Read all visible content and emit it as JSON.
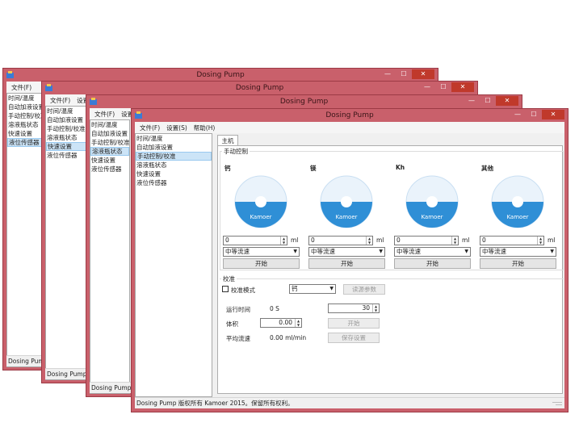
{
  "app": {
    "title": "Dosing Pump",
    "min_glyph": "—",
    "max_glyph": "☐",
    "close_glyph": "✕"
  },
  "menu": {
    "file": "文件(F)",
    "settings": "设置(S)",
    "help": "帮助(H)",
    "settings_truncated": "设置"
  },
  "nav_items": [
    "时间/温度",
    "自动加液设置",
    "手动控制/校准",
    "溶液瓶状态",
    "快速设置",
    "液位传感器"
  ],
  "back_windows": {
    "w1_nav": [
      "时间/温度",
      "自动加液设置",
      "手动控制/校准",
      "溶液瓶状态",
      "快速设置",
      "液位传感器"
    ],
    "w1_selected": "液位传感器",
    "w1_status": "Dosing Pum",
    "w2_nav": [
      "时间/温度",
      "自动加液设置",
      "手动控制/校准",
      "溶液瓶状态",
      "快速设置",
      "液位传感器"
    ],
    "w2_selected": "快速设置",
    "w2_status": "Dosing Pump",
    "w3_nav": [
      "时间/温度",
      "自动加液设置",
      "手动控制/校准",
      "溶液瓶状态",
      "快速设置",
      "液位传感器"
    ],
    "w3_selected": "溶液瓶状态",
    "w3_status": "Dosing Pump"
  },
  "main": {
    "selected_nav": "手动控制/校准",
    "tab_label": "主机",
    "manual_group": "手动控制",
    "logo": "Kamoer",
    "pumps": [
      {
        "name": "钙",
        "volume": "0",
        "unit": "ml",
        "speed": "中等流速",
        "start": "开始"
      },
      {
        "name": "镁",
        "volume": "0",
        "unit": "ml",
        "speed": "中等流速",
        "start": "开始"
      },
      {
        "name": "Kh",
        "volume": "0",
        "unit": "ml",
        "speed": "中等流速",
        "start": "开始"
      },
      {
        "name": "其他",
        "volume": "0",
        "unit": "ml",
        "speed": "中等流速",
        "start": "开始"
      }
    ],
    "calib": {
      "group": "校准",
      "mode_label": "校准模式",
      "mode_checked": false,
      "channel": "钙",
      "read_params": "读源参数",
      "run_time_label": "运行时间",
      "run_time_value": "0 S",
      "run_time_input": "30",
      "volume_label": "体积",
      "volume_value": "0.00",
      "start": "开始",
      "avg_flow_label": "平均流速",
      "avg_flow_value": "0.00 ml/min",
      "save": "保存设置"
    },
    "status": "Dosing Pump 版权所有 Kamoer 2015。保留所有权利。"
  },
  "colors": {
    "window_frame": "#c9606b",
    "disc_blue": "#2f8fd6",
    "selection": "#cce4f7"
  }
}
